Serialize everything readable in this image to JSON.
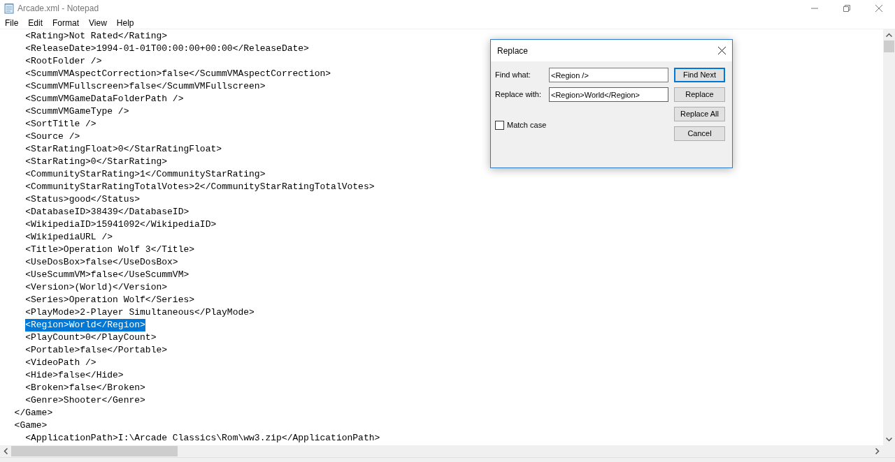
{
  "window": {
    "title": "Arcade.xml - Notepad"
  },
  "menu": [
    "File",
    "Edit",
    "Format",
    "View",
    "Help"
  ],
  "editor": {
    "lines": [
      {
        "text": "    <Rating>Not Rated</Rating>",
        "selected": false
      },
      {
        "text": "    <ReleaseDate>1994-01-01T00:00:00+00:00</ReleaseDate>",
        "selected": false
      },
      {
        "text": "    <RootFolder />",
        "selected": false
      },
      {
        "text": "    <ScummVMAspectCorrection>false</ScummVMAspectCorrection>",
        "selected": false
      },
      {
        "text": "    <ScummVMFullscreen>false</ScummVMFullscreen>",
        "selected": false
      },
      {
        "text": "    <ScummVMGameDataFolderPath />",
        "selected": false
      },
      {
        "text": "    <ScummVMGameType />",
        "selected": false
      },
      {
        "text": "    <SortTitle />",
        "selected": false
      },
      {
        "text": "    <Source />",
        "selected": false
      },
      {
        "text": "    <StarRatingFloat>0</StarRatingFloat>",
        "selected": false
      },
      {
        "text": "    <StarRating>0</StarRating>",
        "selected": false
      },
      {
        "text": "    <CommunityStarRating>1</CommunityStarRating>",
        "selected": false
      },
      {
        "text": "    <CommunityStarRatingTotalVotes>2</CommunityStarRatingTotalVotes>",
        "selected": false
      },
      {
        "text": "    <Status>good</Status>",
        "selected": false
      },
      {
        "text": "    <DatabaseID>38439</DatabaseID>",
        "selected": false
      },
      {
        "text": "    <WikipediaID>15941092</WikipediaID>",
        "selected": false
      },
      {
        "text": "    <WikipediaURL />",
        "selected": false
      },
      {
        "text": "    <Title>Operation Wolf 3</Title>",
        "selected": false
      },
      {
        "text": "    <UseDosBox>false</UseDosBox>",
        "selected": false
      },
      {
        "text": "    <UseScummVM>false</UseScummVM>",
        "selected": false
      },
      {
        "text": "    <Version>(World)</Version>",
        "selected": false
      },
      {
        "text": "    <Series>Operation Wolf</Series>",
        "selected": false
      },
      {
        "text": "    <PlayMode>2-Player Simultaneous</PlayMode>",
        "selected": false
      },
      {
        "text": "    <Region>World</Region>",
        "selected": true
      },
      {
        "text": "    <PlayCount>0</PlayCount>",
        "selected": false
      },
      {
        "text": "    <Portable>false</Portable>",
        "selected": false
      },
      {
        "text": "    <VideoPath />",
        "selected": false
      },
      {
        "text": "    <Hide>false</Hide>",
        "selected": false
      },
      {
        "text": "    <Broken>false</Broken>",
        "selected": false
      },
      {
        "text": "    <Genre>Shooter</Genre>",
        "selected": false
      },
      {
        "text": "  </Game>",
        "selected": false
      },
      {
        "text": "  <Game>",
        "selected": false
      },
      {
        "text": "    <ApplicationPath>I:\\Arcade Classics\\Rom\\ww3.zip</ApplicationPath>",
        "selected": false
      }
    ]
  },
  "dialog": {
    "title": "Replace",
    "fields": [
      {
        "label": "Find what:",
        "value": "<Region />",
        "focused": false
      },
      {
        "label": "Replace with:",
        "value": "<Region>World</Region>",
        "focused": true
      }
    ],
    "buttons": [
      {
        "label": "Find Next",
        "default": true
      },
      {
        "label": "Replace",
        "default": false
      },
      {
        "label": "Replace All",
        "default": false
      },
      {
        "label": "Cancel",
        "default": false
      }
    ],
    "match_case": {
      "label": "Match case",
      "checked": false
    }
  }
}
